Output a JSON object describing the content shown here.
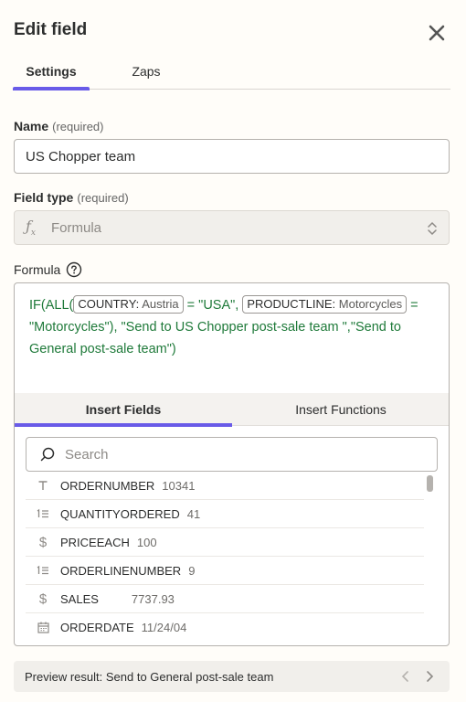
{
  "header": {
    "title": "Edit field"
  },
  "tabs": [
    {
      "label": "Settings"
    },
    {
      "label": "Zaps"
    }
  ],
  "name_field": {
    "label": "Name",
    "required": "(required)",
    "value": "US Chopper team"
  },
  "type_field": {
    "label": "Field type",
    "required": "(required)",
    "value": "Formula",
    "icon": "fx-icon"
  },
  "formula": {
    "label": "Formula",
    "t1": "IF(ALL(",
    "chip1": {
      "name": "COUNTRY:",
      "value": "Austria"
    },
    "t2": " = \"USA\", ",
    "chip2": {
      "name": "PRODUCTLINE:",
      "value": "Motorcycles"
    },
    "t3": " = \"Motorcycles\"), \"Send to US Chopper post-sale team \",\"Send to General post-sale team\")"
  },
  "insert_tabs": [
    {
      "label": "Insert Fields"
    },
    {
      "label": "Insert Functions"
    }
  ],
  "search": {
    "placeholder": "Search"
  },
  "fields": [
    {
      "icon": "text-icon",
      "name": "ORDERNUMBER",
      "value": "10341"
    },
    {
      "icon": "number-icon",
      "name": "QUANTITYORDERED",
      "value": "41"
    },
    {
      "icon": "dollar-icon",
      "name": "PRICEEACH",
      "value": "100"
    },
    {
      "icon": "number-icon",
      "name": "ORDERLINENUMBER",
      "value": "9"
    },
    {
      "icon": "dollar-icon",
      "name": "SALES",
      "value": "7737.93"
    },
    {
      "icon": "calendar-icon",
      "name": "ORDERDATE",
      "value": "11/24/04"
    }
  ],
  "preview": {
    "text": "Preview result: Send to General post-sale team"
  },
  "colors": {
    "accent": "#695be8",
    "formula_text": "#1f7a3a",
    "background": "#fffdf9"
  }
}
